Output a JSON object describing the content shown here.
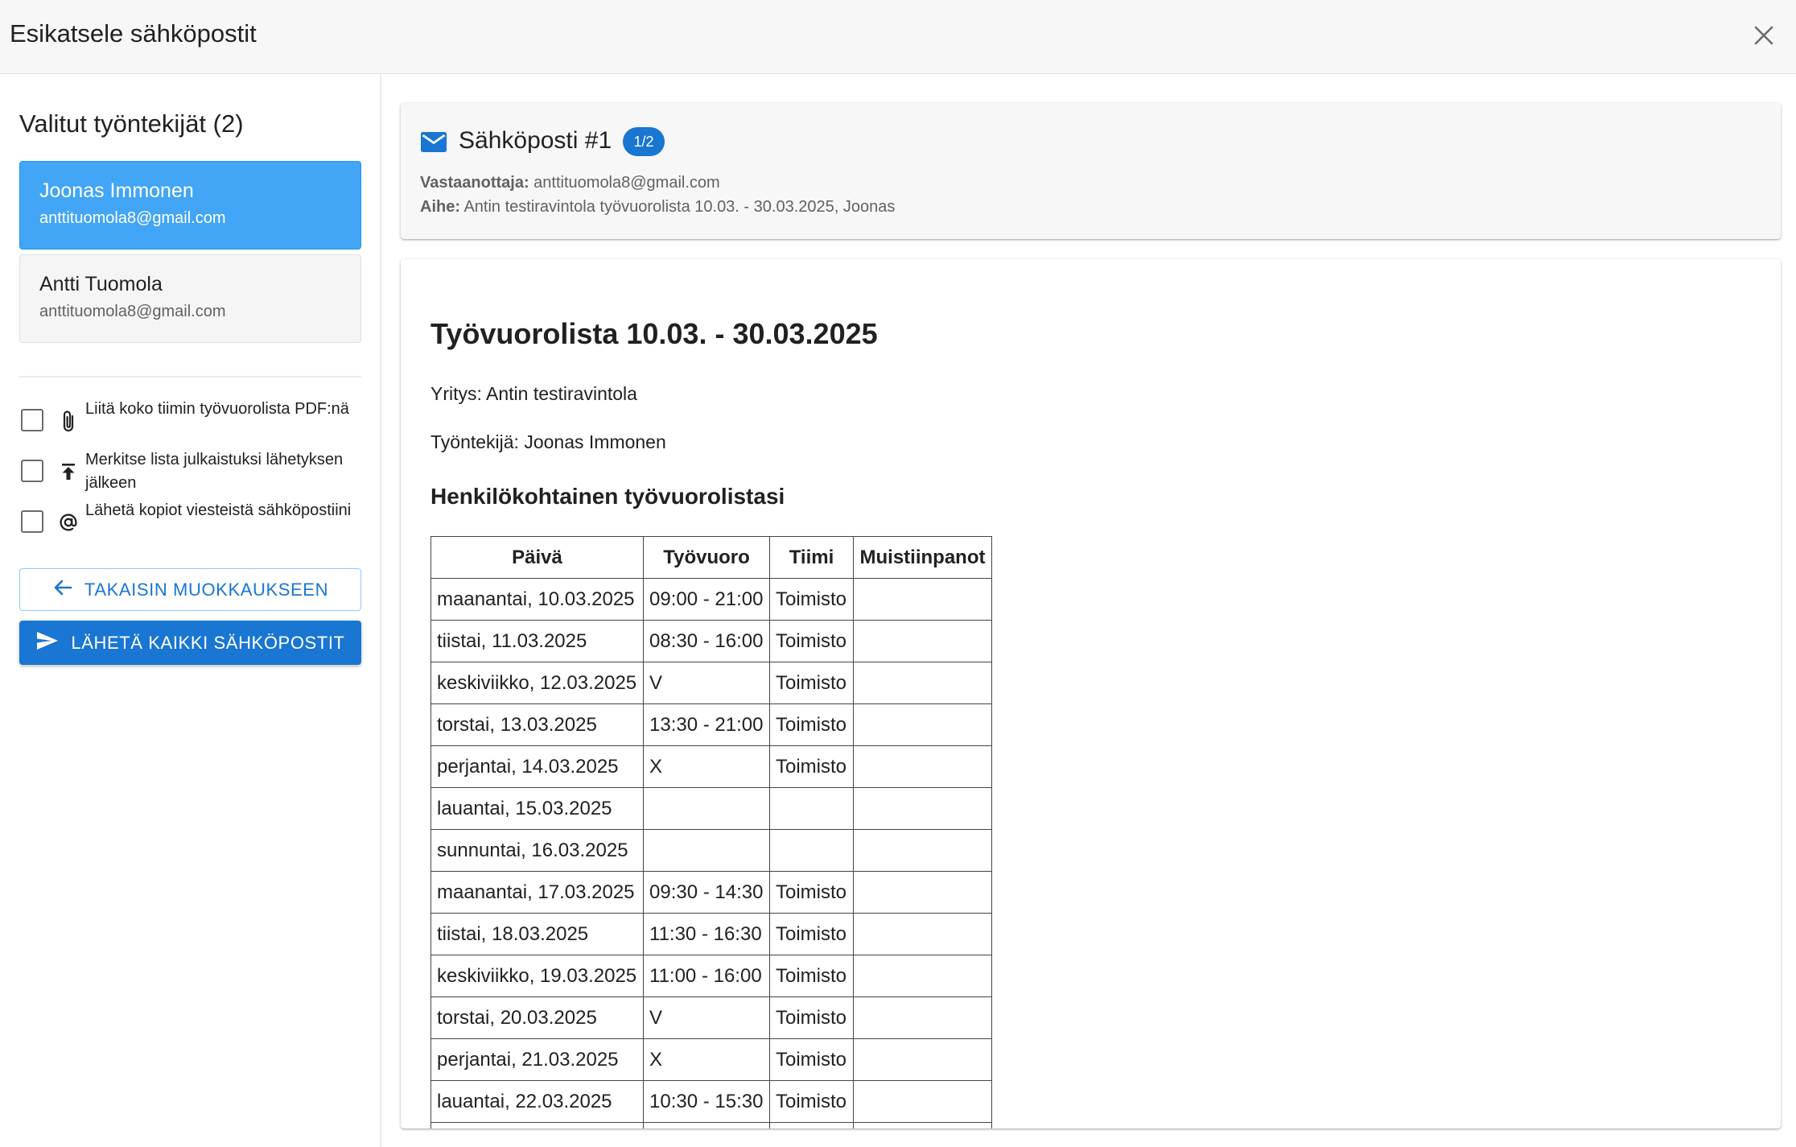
{
  "dialog": {
    "title": "Esikatsele sähköpostit"
  },
  "sidebar": {
    "heading": "Valitut työntekijät (2)",
    "employees": [
      {
        "name": "Joonas Immonen",
        "email": "anttituomola8@gmail.com",
        "selected": true
      },
      {
        "name": "Antti Tuomola",
        "email": "anttituomola8@gmail.com",
        "selected": false
      }
    ],
    "options": [
      {
        "label": "Liitä koko tiimin työvuorolista PDF:nä",
        "icon": "paperclip-icon",
        "checked": false
      },
      {
        "label": "Merkitse lista julkaistuksi lähetyksen jälkeen",
        "icon": "publish-icon",
        "checked": false
      },
      {
        "label": "Lähetä kopiot viesteistä sähköpostiini",
        "icon": "at-sign-icon",
        "checked": false
      }
    ],
    "back_button": "TAKAISIN MUOKKAUKSEEN",
    "send_button": "LÄHETÄ KAIKKI SÄHKÖPOSTIT"
  },
  "email_header": {
    "title": "Sähköposti #1",
    "badge": "1/2",
    "recipient_label": "Vastaanottaja:",
    "recipient": "anttituomola8@gmail.com",
    "subject_label": "Aihe:",
    "subject": "Antin testiravintola työvuorolista 10.03. - 30.03.2025, Joonas"
  },
  "email_body": {
    "title": "Työvuorolista 10.03. - 30.03.2025",
    "company_line": "Yritys: Antin testiravintola",
    "employee_line": "Työntekijä: Joonas Immonen",
    "section_title": "Henkilökohtainen työvuorolistasi",
    "table": {
      "headers": [
        "Päivä",
        "Työvuoro",
        "Tiimi",
        "Muistiinpanot"
      ],
      "rows": [
        [
          "maanantai, 10.03.2025",
          "09:00 - 21:00",
          "Toimisto",
          ""
        ],
        [
          "tiistai, 11.03.2025",
          "08:30 - 16:00",
          "Toimisto",
          ""
        ],
        [
          "keskiviikko, 12.03.2025",
          "V",
          "Toimisto",
          ""
        ],
        [
          "torstai, 13.03.2025",
          "13:30 - 21:00",
          "Toimisto",
          ""
        ],
        [
          "perjantai, 14.03.2025",
          "X",
          "Toimisto",
          ""
        ],
        [
          "lauantai, 15.03.2025",
          "",
          "",
          ""
        ],
        [
          "sunnuntai, 16.03.2025",
          "",
          "",
          ""
        ],
        [
          "maanantai, 17.03.2025",
          "09:30 - 14:30",
          "Toimisto",
          ""
        ],
        [
          "tiistai, 18.03.2025",
          "11:30 - 16:30",
          "Toimisto",
          ""
        ],
        [
          "keskiviikko, 19.03.2025",
          "11:00 - 16:00",
          "Toimisto",
          ""
        ],
        [
          "torstai, 20.03.2025",
          "V",
          "Toimisto",
          ""
        ],
        [
          "perjantai, 21.03.2025",
          "X",
          "Toimisto",
          ""
        ],
        [
          "lauantai, 22.03.2025",
          "10:30 - 15:30",
          "Toimisto",
          ""
        ],
        [
          "",
          "",
          "",
          ""
        ]
      ]
    }
  },
  "colors": {
    "primary": "#1976d2",
    "selected_card": "#42a5f5",
    "badge": "#1976d2"
  }
}
